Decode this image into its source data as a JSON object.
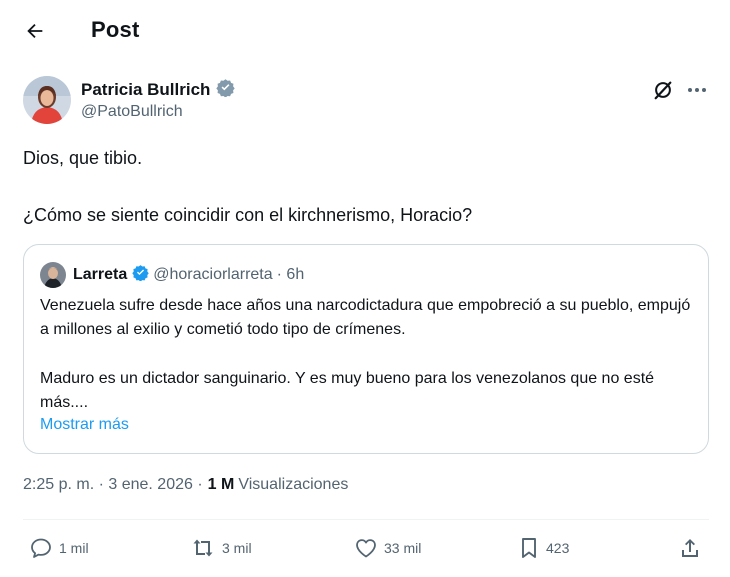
{
  "header": {
    "title": "Post"
  },
  "post": {
    "author": {
      "name": "Patricia Bullrich",
      "handle": "@PatoBullrich",
      "verified": true
    },
    "text_lines": [
      "Dios, que tibio.",
      "¿Cómo se siente coincidir con el kirchnerismo, Horacio?"
    ],
    "quoted": {
      "name": "Larreta",
      "handle": "@horaciorlarreta",
      "time": "· 6h",
      "verified": true,
      "paragraph1": "Venezuela sufre desde hace años una narcodictadura que empobreció a su pueblo, empujó a millones al exilio y cometió todo tipo de crímenes.",
      "paragraph2": "Maduro es un dictador sanguinario. Y es muy bueno para los venezolanos que no esté más....",
      "show_more": "Mostrar más"
    },
    "timestamp": "2:25 p. m. · 3 ene. 2026 ·",
    "views_count": "1 M",
    "views_label": "Visualizaciones"
  },
  "actions": {
    "replies": "1 mil",
    "reposts": "3 mil",
    "likes": "33 mil",
    "bookmarks": "423"
  },
  "colors": {
    "text": "#0f1419",
    "secondary": "#536471",
    "accent": "#1d9bf0",
    "border": "#cfd9de"
  },
  "icons": [
    "back-arrow-icon",
    "verified-badge-icon",
    "grok-icon",
    "more-icon",
    "reply-icon",
    "repost-icon",
    "like-icon",
    "bookmark-icon",
    "share-icon"
  ]
}
